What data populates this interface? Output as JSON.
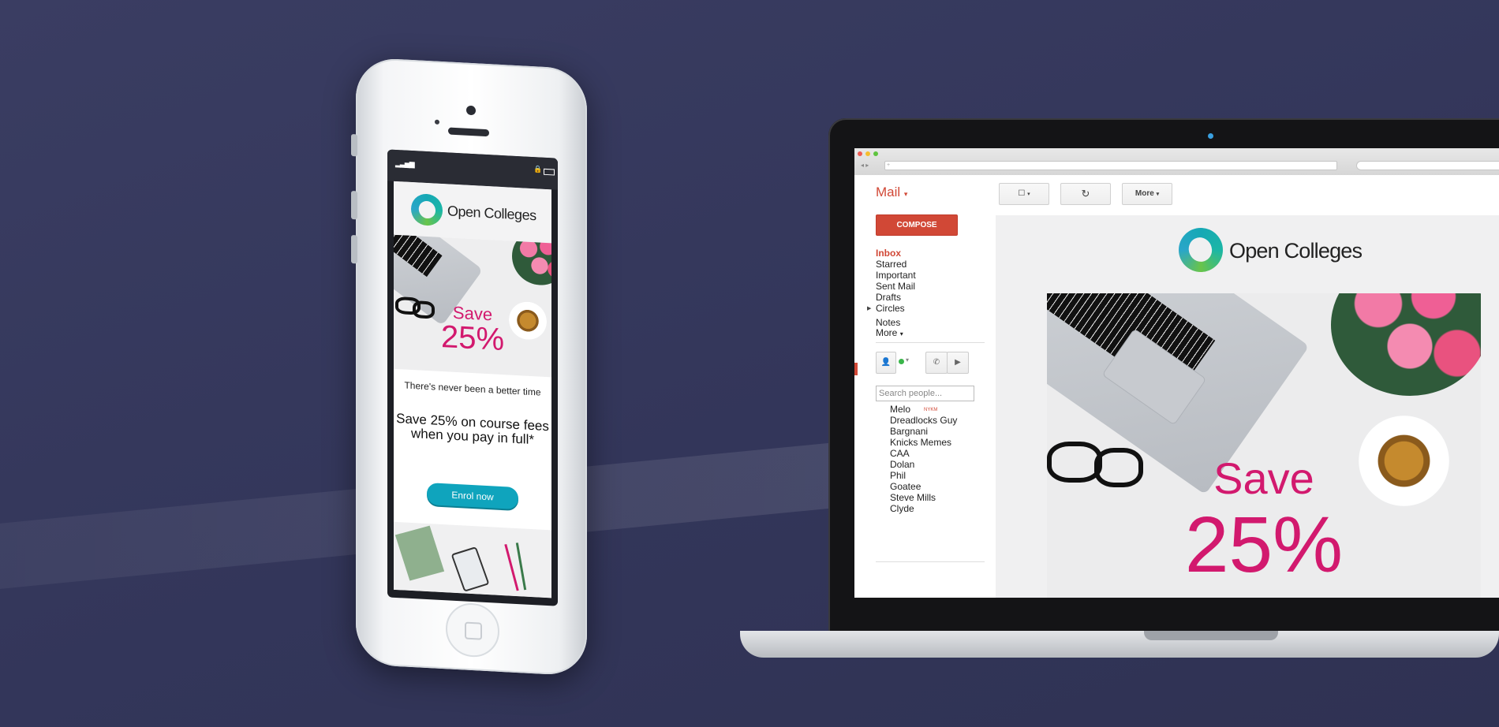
{
  "brand": {
    "name": "Open Colleges",
    "accent": "#d2196e",
    "teal": "#0fa4bd"
  },
  "phone_email": {
    "save_word": "Save",
    "save_percent": "25%",
    "tagline": "There's never been a better time",
    "offer": "Save 25% on course fees when you pay in full*",
    "cta": "Enrol now"
  },
  "gmail": {
    "app_menu": "Mail",
    "compose": "COMPOSE",
    "folders": [
      {
        "label": "Inbox"
      },
      {
        "label": "Starred"
      },
      {
        "label": "Important"
      },
      {
        "label": "Sent Mail"
      },
      {
        "label": "Drafts"
      },
      {
        "label": "Circles"
      }
    ],
    "notes": "Notes",
    "more": "More",
    "search_people_placeholder": "Search people...",
    "contacts": [
      {
        "name": "Melo",
        "badge": "NYKM"
      },
      {
        "name": "Dreadlocks Guy"
      },
      {
        "name": "Bargnani"
      },
      {
        "name": "Knicks Memes"
      },
      {
        "name": "CAA"
      },
      {
        "name": "Dolan"
      },
      {
        "name": "Phil"
      },
      {
        "name": "Goatee"
      },
      {
        "name": "Steve Mills"
      },
      {
        "name": "Clyde"
      }
    ],
    "toolbar": {
      "more": "More"
    },
    "search_bar_placeholder": "",
    "colors": {
      "red": "#d14836"
    }
  },
  "email_body": {
    "save_word": "Save",
    "save_percent": "25%"
  },
  "icons": [
    "signal-icon",
    "lock-icon",
    "battery-icon",
    "checkbox-icon",
    "refresh-icon",
    "phone-icon",
    "video-icon",
    "person-icon",
    "status-dot-icon",
    "caret-icon"
  ]
}
